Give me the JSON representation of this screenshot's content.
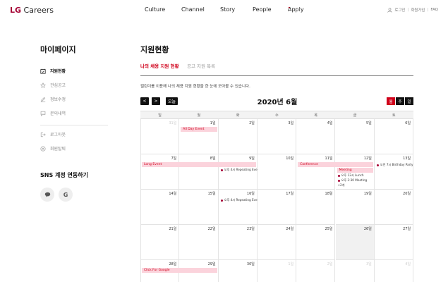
{
  "header": {
    "logo": "LG Careers",
    "logo_brand": "LG",
    "logo_rest": " Careers",
    "nav": [
      "Culture",
      "Channel",
      "Story",
      "People",
      "Apply"
    ],
    "apply_dot": "•",
    "util": [
      "로그인",
      "회원가입",
      "FAQ"
    ]
  },
  "side": {
    "title": "마이페이지",
    "menu": [
      "지원현황",
      "관심공고",
      "정보수정",
      "문의내역"
    ],
    "menu2": [
      "로그아웃",
      "회원탈퇴"
    ],
    "sns_title": "SNS 계정 연동하기",
    "sns_buttons": [
      "talk",
      "G"
    ]
  },
  "main": {
    "title": "지원현황",
    "tabs": [
      "나의 채용 지원 현황",
      "공고 지원 목록"
    ],
    "desc": "캘린더를 이용해 나의 채용 지원 현황을 한 눈에 모아볼 수 있습니다.",
    "prev": "<",
    "next": ">",
    "today": "오늘",
    "calendar_title": "2020년 6월",
    "views": [
      "월",
      "주",
      "일"
    ]
  },
  "calendar": {
    "dow": [
      "일",
      "월",
      "화",
      "수",
      "목",
      "금",
      "토"
    ],
    "weeks": [
      [
        "31일",
        "1일",
        "2일",
        "3일",
        "4일",
        "5일",
        "6일"
      ],
      [
        "7일",
        "8일",
        "9일",
        "10일",
        "11일",
        "12일",
        "13일"
      ],
      [
        "14일",
        "15일",
        "16일",
        "17일",
        "18일",
        "19일",
        "20일"
      ],
      [
        "21일",
        "22일",
        "23일",
        "24일",
        "25일",
        "26일",
        "27일"
      ],
      [
        "28일",
        "29일",
        "30일",
        "1일",
        "2일",
        "3일",
        "4일"
      ]
    ],
    "events": {
      "all_day": "All Day Event",
      "long": "Long Event",
      "conference": "Conference",
      "meeting": "Meeting",
      "repeating_1": "오후 4시 Repeating Eve",
      "repeating_2": "오후 4시 Repeating Eve",
      "lunch": "오후 12시 Lunch",
      "meeting_230": "오후 2:30 Meeting",
      "more": "+2개",
      "birthday": "오전 7시 Birthday Party",
      "click_google": "Click For Google"
    }
  }
}
